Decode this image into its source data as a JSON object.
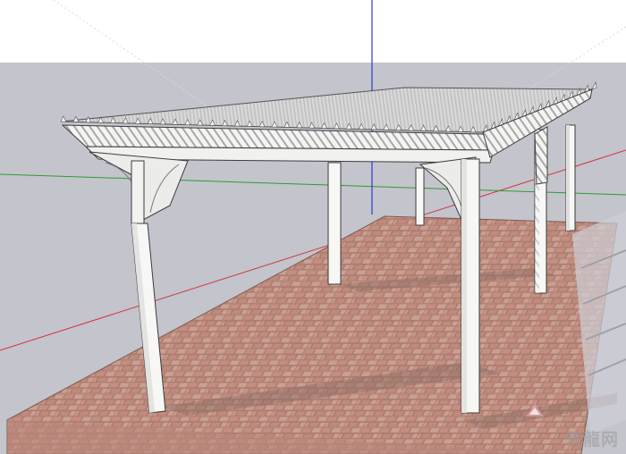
{
  "viewport": {
    "sky_color": "#ffffff",
    "ground_color": "#c3c4cc",
    "floor_color": "#c79688",
    "floor_grout_color": "#9c6f63",
    "structure_color": "#f7f7f5",
    "structure_edge_color": "#3c3c3c",
    "axes": {
      "red": "#d2353a",
      "green": "#2f9a36",
      "blue": "#2d3bd6"
    }
  },
  "model": {
    "name": "pergola",
    "post_count": 6
  },
  "watermark": {
    "icon": "logo-icon",
    "text": "筑龍网"
  }
}
